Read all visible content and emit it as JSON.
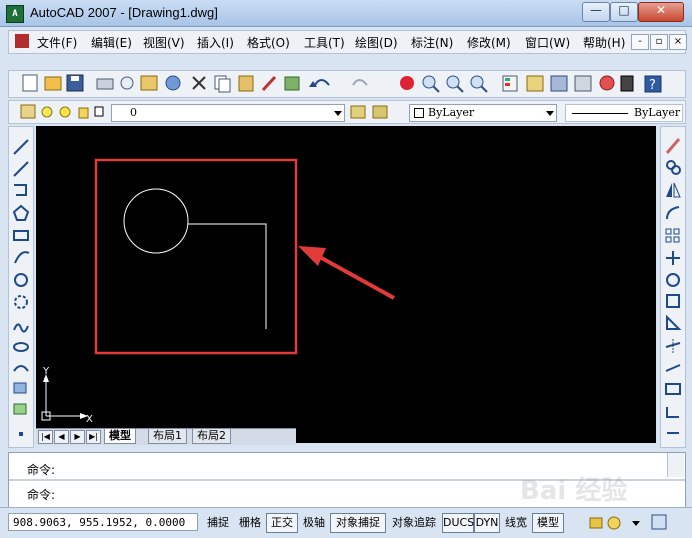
{
  "window": {
    "title": "AutoCAD 2007 - [Drawing1.dwg]",
    "app_icon": "autocad-icon",
    "controls": {
      "minimize": "—",
      "maximize": "□",
      "close": "✕"
    }
  },
  "menubar": {
    "items": [
      {
        "label": "文件(F)"
      },
      {
        "label": "编辑(E)"
      },
      {
        "label": "视图(V)"
      },
      {
        "label": "插入(I)"
      },
      {
        "label": "格式(O)"
      },
      {
        "label": "工具(T)"
      },
      {
        "label": "绘图(D)"
      },
      {
        "label": "标注(N)"
      },
      {
        "label": "修改(M)"
      },
      {
        "label": "窗口(W)"
      },
      {
        "label": "帮助(H)"
      }
    ],
    "doc_controls": {
      "minimize": "-",
      "restore": "▫",
      "close": "×"
    }
  },
  "layer_toolbar": {
    "layer_value": "0",
    "color_value": "ByLayer",
    "linetype_value": "ByLayer"
  },
  "tabs": {
    "items": [
      {
        "label": "模型"
      },
      {
        "label": "布局1"
      },
      {
        "label": "布局2"
      }
    ],
    "nav": [
      "|◀",
      "◀",
      "▶",
      "▶|"
    ]
  },
  "ucs": {
    "x_label": "X",
    "y_label": "Y"
  },
  "command": {
    "line1": "命令:",
    "line2": "命令:"
  },
  "status": {
    "coords": "908.9063,  955.1952, 0.0000",
    "buttons": [
      {
        "label": "捕捉",
        "on": false
      },
      {
        "label": "栅格",
        "on": false
      },
      {
        "label": "正交",
        "on": true
      },
      {
        "label": "极轴",
        "on": false
      },
      {
        "label": "对象捕捉",
        "on": true
      },
      {
        "label": "对象追踪",
        "on": false
      },
      {
        "label": "DUCS",
        "on": true
      },
      {
        "label": "DYN",
        "on": true
      },
      {
        "label": "线宽",
        "on": false
      },
      {
        "label": "模型",
        "on": true
      }
    ]
  },
  "colors": {
    "canvas": "#000000",
    "annotation_red": "#e03a3a",
    "geometry": "#ffffff"
  },
  "watermark": "Bai 经验"
}
